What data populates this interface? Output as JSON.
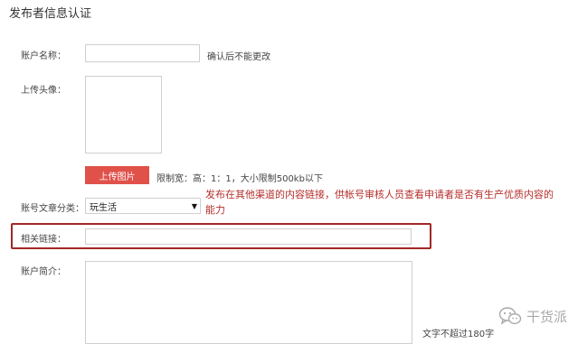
{
  "page_title": "发布者信息认证",
  "account_name": {
    "label": "账户名称：",
    "value": "",
    "hint": "确认后不能更改"
  },
  "avatar": {
    "label": "上传头像：",
    "upload_button": "上传图片",
    "hint": "限制宽：高：1：1，大小限制500kb以下"
  },
  "category": {
    "label": "账号文章分类：",
    "selected": "玩生活"
  },
  "annotation_text": "发布在其他渠道的内容链接，供帐号审核人员查看申请者是否有生产优质内容的能力",
  "related_link": {
    "label": "相关链接：",
    "value": ""
  },
  "intro": {
    "label": "账户简介：",
    "value": "",
    "hint": "文字不超过180字"
  },
  "watermark": {
    "text": "干货派",
    "icon": "wechat-icon"
  },
  "colors": {
    "upload_button": "#e0514a",
    "annotation": "#b4302c",
    "highlight_border": "#a32727"
  }
}
